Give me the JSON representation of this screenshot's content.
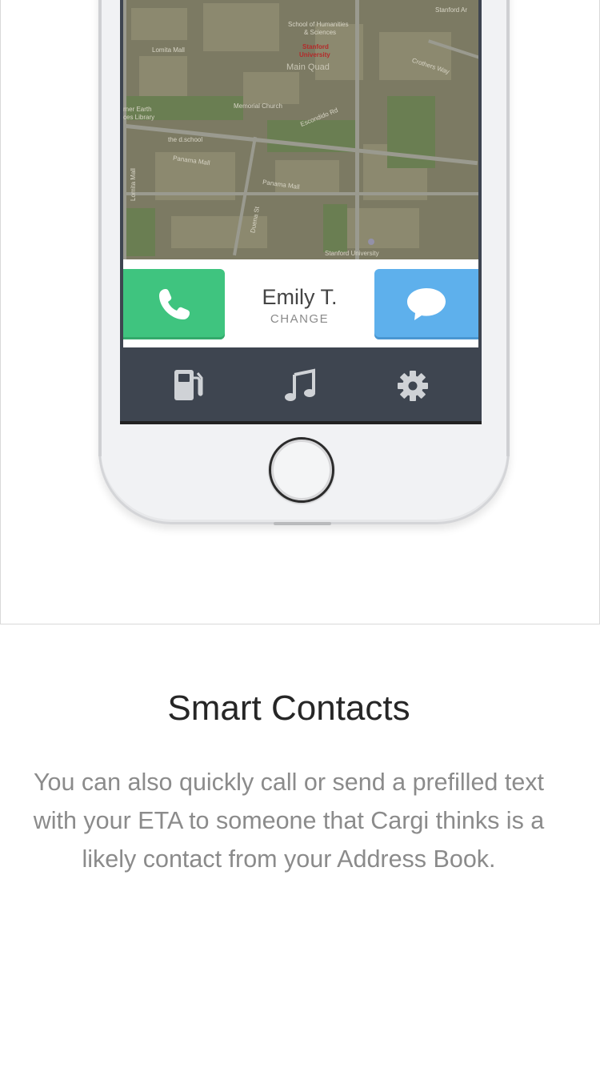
{
  "map": {
    "labels": {
      "stanford_arts": "Stanford Ar",
      "school_humanities": "School of Humanities",
      "school_humanities_2": "& Sciences",
      "stanford": "Stanford",
      "university": "University",
      "main_quad": "Main Quad",
      "lomita_mall": "Lomita Mall",
      "crothers_way": "Crothers Way",
      "memorial_church": "Memorial Church",
      "escondido_rd": "Escondido Rd",
      "earth_library": "rner Earth",
      "earth_library_2": "ces Library",
      "d_school": "the d.school",
      "panama_mall": "Panama Mall",
      "panama_mall_2": "Panama Mall",
      "lomita_mall_v": "Lomita Mall",
      "duena_st": "Duena St",
      "stanford_university": "Stanford University"
    }
  },
  "contact": {
    "name": "Emily T.",
    "change_label": "CHANGE",
    "call_icon": "phone-icon",
    "message_icon": "chat-bubble-icon",
    "call_color": "#3fc47f",
    "message_color": "#5eb0ec"
  },
  "tabs": [
    {
      "icon": "gas-pump-icon"
    },
    {
      "icon": "music-note-icon"
    },
    {
      "icon": "gear-icon"
    }
  ],
  "content": {
    "title": "Smart Contacts",
    "description": "You can also quickly call or send a prefilled text with your ETA to someone that Cargi thinks is a likely contact from your Address Book."
  }
}
